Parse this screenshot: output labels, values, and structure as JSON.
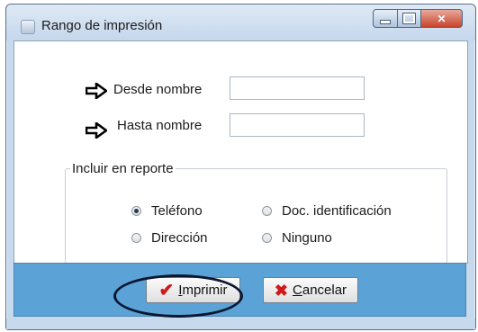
{
  "window": {
    "title": "Rango de impresión"
  },
  "form": {
    "from_label": "Desde nombre",
    "from_value": "",
    "to_label": "Hasta nombre",
    "to_value": ""
  },
  "include_group": {
    "legend": "Incluir en reporte",
    "options": [
      {
        "label": "Teléfono",
        "checked": true
      },
      {
        "label": "Doc. identificación",
        "checked": false
      },
      {
        "label": "Dirección",
        "checked": false
      },
      {
        "label": "Ninguno",
        "checked": false
      }
    ]
  },
  "buttons": {
    "print_label": "Imprimir",
    "cancel_label": "Cancelar"
  },
  "icons": {
    "field_marker": "right-arrow-icon",
    "print": "checkmark-icon",
    "cancel": "x-icon"
  },
  "colors": {
    "bottom_bar": "#5ba3d6",
    "check": "#d01818",
    "close_button": "#c7442c"
  }
}
